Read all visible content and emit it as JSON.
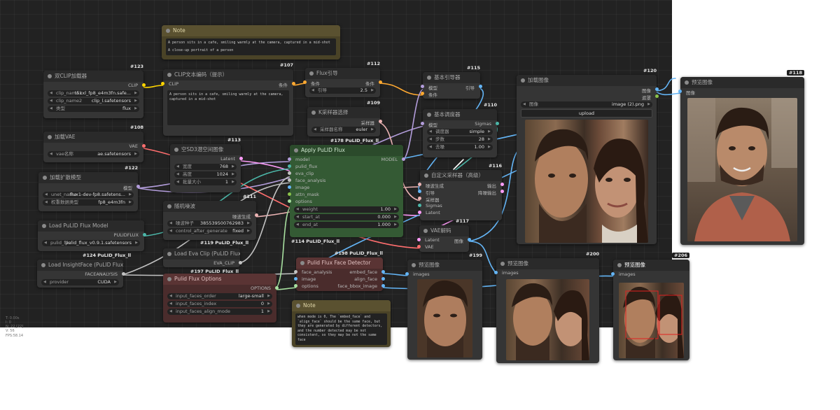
{
  "stats": [
    "T: 0.00s",
    "I: 0",
    "N: 22 [22]",
    "V: 56",
    "FPS:58.14"
  ],
  "nodes": {
    "note1": {
      "title": "Note",
      "lines": [
        "A person sits in a cafe, smiling warmly at the camera, captured in a mid-shot",
        "A close-up portrait of a person"
      ]
    },
    "dualclip": {
      "title": "双CLIP加载器",
      "id": "#123",
      "out_clip": "CLIP",
      "w": [
        {
          "label": "clip_name1",
          "value": "t5xxl_fp8_e4m3fn.safe..."
        },
        {
          "label": "clip_name2",
          "value": "clip_l.safetensors"
        },
        {
          "label": "类型",
          "value": "flux"
        }
      ]
    },
    "clipenc": {
      "title": "CLIP文本编码（提示）",
      "id": "#107",
      "in_clip": "CLIP",
      "out": "条件",
      "text": "A person sits in a cafe, smiling warmly at the camera, captured in a mid-shot"
    },
    "fluxguide": {
      "title": "Flux引导",
      "id": "#112",
      "in": "条件",
      "out": "条件",
      "w_label": "引导",
      "w_value": "2.5"
    },
    "ksampsel": {
      "title": "K采样器选择",
      "id": "#109",
      "out": "采样器",
      "w_label": "采样器名称",
      "w_value": "euler",
      "sub": "#178 PuLID_Flux_ll"
    },
    "basicguide": {
      "title": "基本引导器",
      "id": "#115",
      "in1": "模型",
      "in2": "条件",
      "out": "引导"
    },
    "basicsched": {
      "title": "基本调度器",
      "id": "#110",
      "in": "模型",
      "out": "Sigmas",
      "w": [
        {
          "label": "调度器",
          "value": "simple"
        },
        {
          "label": "步数",
          "value": "28"
        },
        {
          "label": "去噪",
          "value": "1.00"
        }
      ]
    },
    "loadimg": {
      "title": "加载图像",
      "id": "#120",
      "out1": "图像",
      "out2": "遮罩",
      "w_label": "图像",
      "w_value": "image (2).png",
      "upload": "upload"
    },
    "preview118": {
      "title": "预览图像",
      "id": "#118",
      "in": "图像"
    },
    "vae": {
      "title": "加载VAE",
      "id": "#108",
      "out": "VAE",
      "w_label": "vae名称",
      "w_value": "ae.safetensors"
    },
    "emptysd3": {
      "title": "空SD3潜空间图像",
      "id": "#113",
      "out": "Latent",
      "w": [
        {
          "label": "宽度",
          "value": "768"
        },
        {
          "label": "高度",
          "value": "1024"
        },
        {
          "label": "批量大小",
          "value": "1"
        }
      ]
    },
    "applypulid": {
      "title": "Apply PuLID Flux",
      "id": "#114 PuLID_Flux_ll",
      "inputs": [
        "model",
        "pulid_flux",
        "eva_clip",
        "face_analysis",
        "image",
        "attn_mask",
        "options"
      ],
      "out": "MODEL",
      "w": [
        {
          "label": "weight",
          "value": "1.00"
        },
        {
          "label": "start_at",
          "value": "0.000"
        },
        {
          "label": "end_at",
          "value": "1.000"
        }
      ]
    },
    "customsamp": {
      "title": "自定义采样器（高级）",
      "id": "#116",
      "inputs": [
        "噪波生成",
        "引导",
        "采样器",
        "Sigmas",
        "Latent"
      ],
      "out1": "输出",
      "out2": "降噪输出"
    },
    "unet": {
      "title": "加载扩散模型",
      "id": "#122",
      "out": "模型",
      "w": [
        {
          "label": "unet_name",
          "value": "flux1-dev-fp8.safetens..."
        },
        {
          "label": "权重数据类型",
          "value": "fp8_e4m3fn"
        }
      ]
    },
    "noise": {
      "title": "随机噪波",
      "id": "#111",
      "out": "噪波生成",
      "w": [
        {
          "label": "噪波种子",
          "value": "385539500762983"
        },
        {
          "label": "control_after_generate",
          "value": "fixed"
        }
      ]
    },
    "pulidmodel": {
      "title": "Load PuLID Flux Model",
      "id": "#119 PuLID_Flux_ll",
      "out": "PULIDFLUX",
      "w_label": "pulid_file",
      "w_value": "pulid_flux_v0.9.1.safetensors"
    },
    "vaedecode": {
      "title": "VAE解码",
      "id": "#117",
      "in1": "Latent",
      "in2": "VAE",
      "out": "图像"
    },
    "evaclip": {
      "title": "Load Eva Clip (PuLID Flux)",
      "id": "#124 PuLID_Flux_ll",
      "out": "EVA_CLIP",
      "sub": "#197 PuLID_Flux_ll"
    },
    "insight": {
      "title": "Load InsightFace (PuLID Flux)",
      "id": "",
      "out": "FACEANALYSIS",
      "w_label": "provider",
      "w_value": "CUDA"
    },
    "detector": {
      "title": "Pulid Flux Face Detector",
      "id": "#198 PuLID_Flux_ll",
      "inputs": [
        "face_analysis",
        "image",
        "options"
      ],
      "outputs": [
        "embed_face",
        "align_face",
        "face_bbox_image"
      ]
    },
    "options": {
      "title": "Pulid Flux Options",
      "out": "OPTIONS",
      "w": [
        {
          "label": "input_faces_order",
          "value": "large-small"
        },
        {
          "label": "input_faces_index",
          "value": "0"
        },
        {
          "label": "input_faces_align_mode",
          "value": "1"
        }
      ]
    },
    "note2": {
      "title": "Note",
      "text": "when mode is 0, The `embed_face` and `align_face` should be the same face, but they are generated by different detectors, and the number detected may be not consistent, so they may be not the same face"
    },
    "prev199": {
      "title": "预览图像",
      "id": "#199",
      "in": "images"
    },
    "prev200": {
      "title": "预览图像",
      "id": "#200",
      "in": "images"
    },
    "prev206": {
      "title": "预览图像",
      "id": "#206",
      "in": "images"
    }
  },
  "colors": {
    "canvas": "#222222",
    "node": "#353535",
    "note": "#3d3a2a",
    "green": "#345a34",
    "red": "#4a2c2c",
    "clip": "#ffd500",
    "cond": "#ffa931",
    "model": "#b39ddb",
    "latent": "#ff9cf9",
    "vae": "#ff6e6e",
    "image": "#64b5f6",
    "teal": "#4cb6a8",
    "sampler": "#ecb4b4"
  }
}
